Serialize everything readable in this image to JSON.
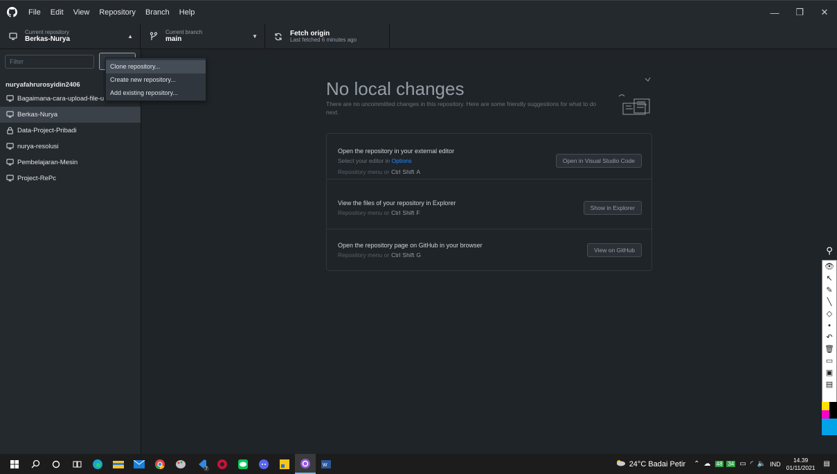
{
  "titlebar": {
    "menu": [
      "File",
      "Edit",
      "View",
      "Repository",
      "Branch",
      "Help"
    ],
    "controls": {
      "minimize": "—",
      "restore": "❐",
      "close": "✕"
    }
  },
  "toolbar": {
    "repo": {
      "caption": "Current repository",
      "value": "Berkas-Nurya"
    },
    "branch": {
      "caption": "Current branch",
      "value": "main"
    },
    "fetch": {
      "caption": "Fetch origin",
      "value": "Last fetched 6 minutes ago"
    }
  },
  "sidebar": {
    "filter_placeholder": "Filter",
    "group": "nuryafahrurosyidin2406",
    "repos": [
      {
        "name": "Bagaimana-cara-upload-file-u",
        "icon": "repo-icon",
        "selected": false
      },
      {
        "name": "Berkas-Nurya",
        "icon": "repo-icon",
        "selected": true
      },
      {
        "name": "Data-Project-Pribadi",
        "icon": "lock-icon",
        "selected": false
      },
      {
        "name": "nurya-resolusi",
        "icon": "repo-icon",
        "selected": false
      },
      {
        "name": "Pembelajaran-Mesin",
        "icon": "repo-icon",
        "selected": false
      },
      {
        "name": "Project-RePc",
        "icon": "repo-icon",
        "selected": false
      }
    ]
  },
  "dropdown": {
    "items": [
      "Clone repository...",
      "Create new repository...",
      "Add existing repository..."
    ]
  },
  "main": {
    "title": "No local changes",
    "description": "There are no uncommitted changes in this repository. Here are some friendly suggestions for what to do next.",
    "suggestions": [
      {
        "title": "Open the repository in your external editor",
        "subtitle_prefix": "Select your editor in ",
        "subtitle_link": "Options",
        "shortcut_prefix": "Repository menu or",
        "keys": [
          "Ctrl",
          "Shift",
          "A"
        ],
        "button": "Open in Visual Studio Code"
      },
      {
        "title": "View the files of your repository in Explorer",
        "shortcut_prefix": "Repository menu or",
        "keys": [
          "Ctrl",
          "Shift",
          "F"
        ],
        "button": "Show in Explorer"
      },
      {
        "title": "Open the repository page on GitHub in your browser",
        "shortcut_prefix": "Repository menu or",
        "keys": [
          "Ctrl",
          "Shift",
          "G"
        ],
        "button": "View on GitHub"
      }
    ]
  },
  "taskbar": {
    "weather": "24°C Badai Petir",
    "tray_badges": [
      "48",
      "34"
    ],
    "language": "IND",
    "time": "14.39",
    "date": "01/11/2021",
    "badge_count": "7"
  },
  "colors": {
    "titlebar": "#24292e",
    "main_bg": "#1f2428",
    "accent_link": "#2188ff"
  }
}
